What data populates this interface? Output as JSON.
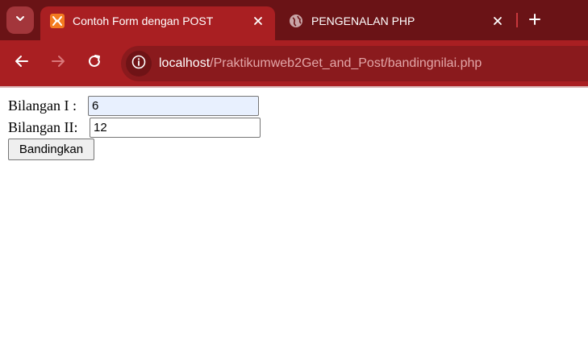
{
  "browser": {
    "tabs": [
      {
        "title": "Contoh Form dengan POST",
        "favicon": "xampp-icon",
        "active": true
      },
      {
        "title": "PENGENALAN PHP",
        "favicon": "globe-icon",
        "active": false
      }
    ],
    "address_bar": {
      "host": "localhost",
      "path": "/Praktikumweb2Get_and_Post/bandingnilai.php"
    },
    "colors": {
      "tabstrip": "#6a1316",
      "toolbar": "#a91f22",
      "omnibox": "#8a1a1d",
      "url_path": "#e3a6a8",
      "favicon_accent": "#f47b20"
    }
  },
  "form": {
    "label_1": "Bilangan I :",
    "value_1": "6",
    "label_2": "Bilangan II:",
    "value_2": "12",
    "submit_label": "Bandingkan"
  }
}
